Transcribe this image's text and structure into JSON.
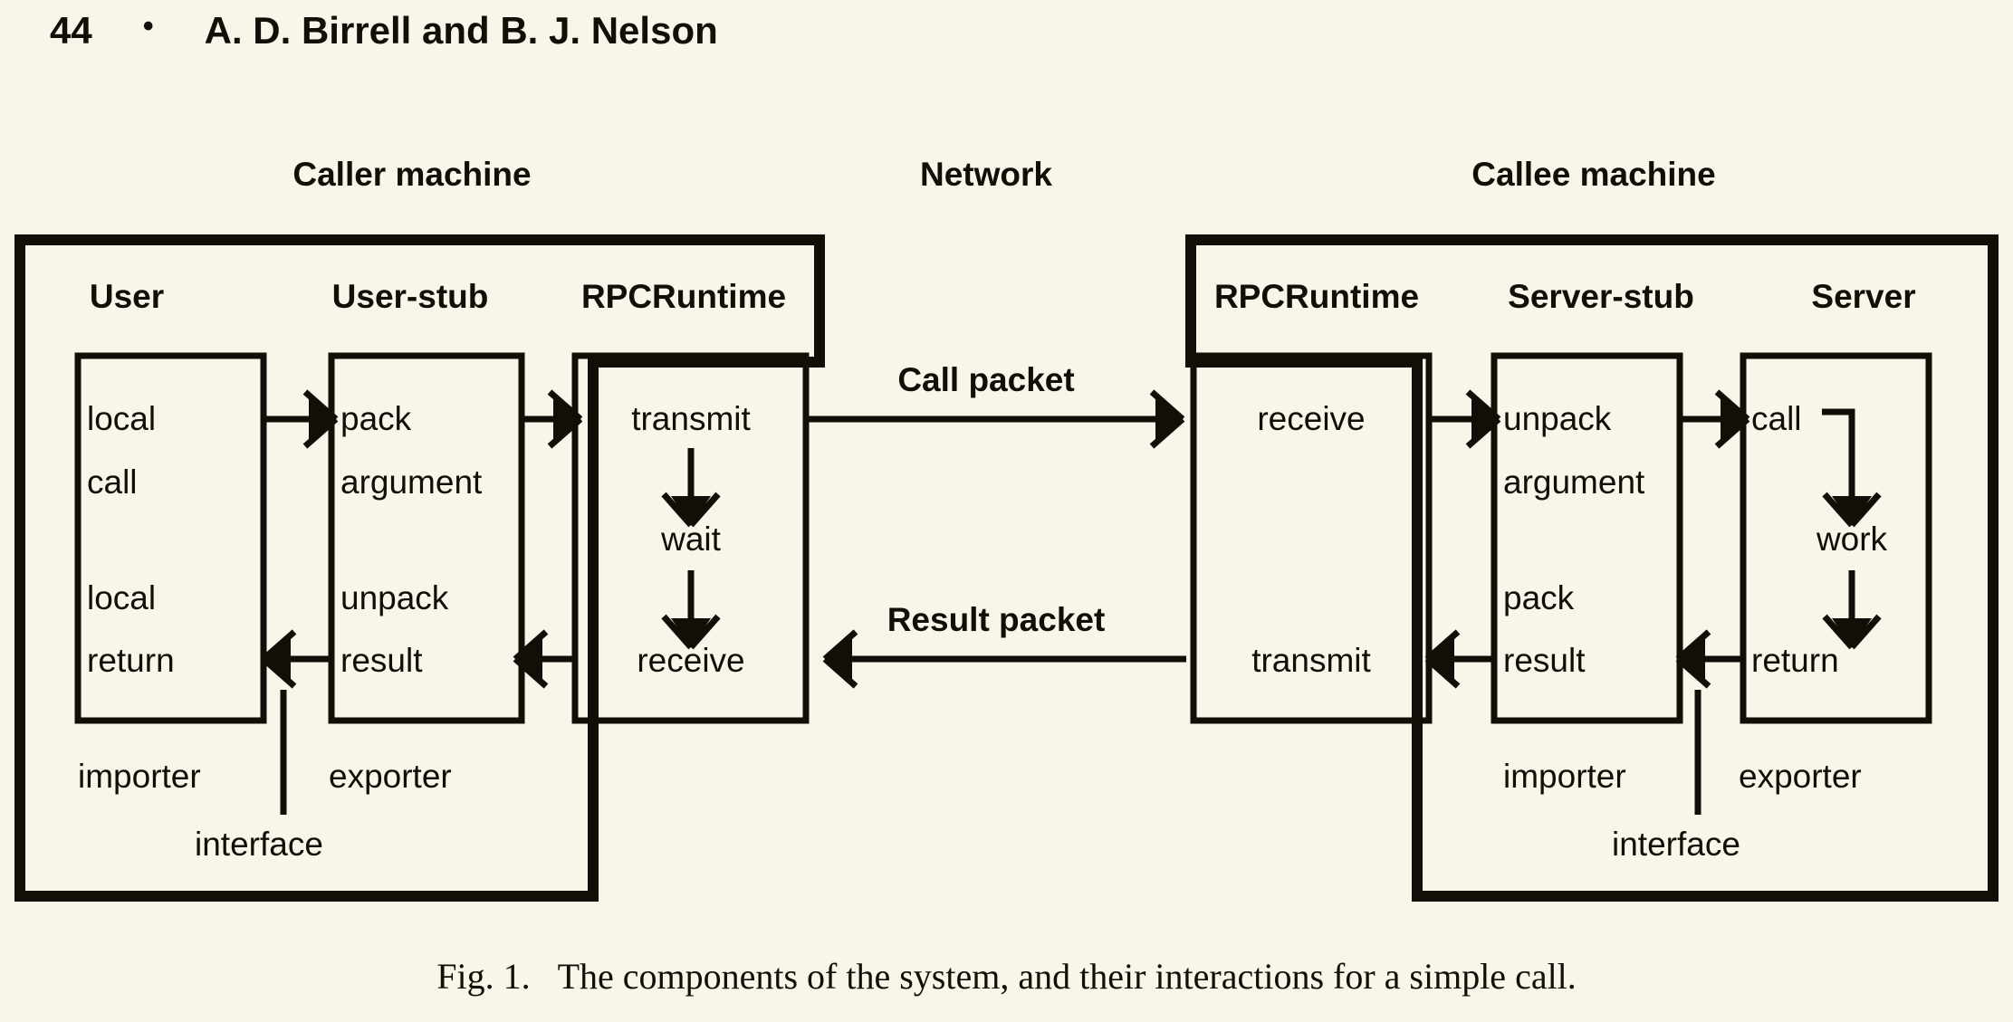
{
  "running_head": {
    "page_number": "44",
    "separator": "•",
    "authors": "A. D. Birrell and B. J. Nelson"
  },
  "figure": {
    "caption_label": "Fig. 1.",
    "caption_text": "The components of the system, and their interactions for a simple call.",
    "background_color": "#faf5e9",
    "ink_color": "#120f08"
  },
  "diagram": {
    "machine_labels": {
      "caller": "Caller machine",
      "network": "Network",
      "callee": "Callee machine"
    },
    "caller": {
      "columns": [
        {
          "title": "User",
          "cells": [
            "local",
            "call",
            "local",
            "return"
          ],
          "role": "importer"
        },
        {
          "title": "User-stub",
          "cells": [
            "pack",
            "argument",
            "unpack",
            "result"
          ],
          "role": "exporter"
        },
        {
          "title": "RPCRuntime",
          "cells": [
            "transmit",
            "wait",
            "receive"
          ],
          "role": ""
        }
      ],
      "interface_label": "interface"
    },
    "callee": {
      "columns": [
        {
          "title": "RPCRuntime",
          "cells": [
            "receive",
            "transmit"
          ],
          "role": ""
        },
        {
          "title": "Server-stub",
          "cells": [
            "unpack",
            "argument",
            "pack",
            "result"
          ],
          "role": "importer"
        },
        {
          "title": "Server",
          "cells": [
            "call",
            "work",
            "return"
          ],
          "role": "exporter"
        }
      ],
      "interface_label": "interface"
    },
    "network_packets": {
      "call": "Call packet",
      "result": "Result packet"
    }
  }
}
